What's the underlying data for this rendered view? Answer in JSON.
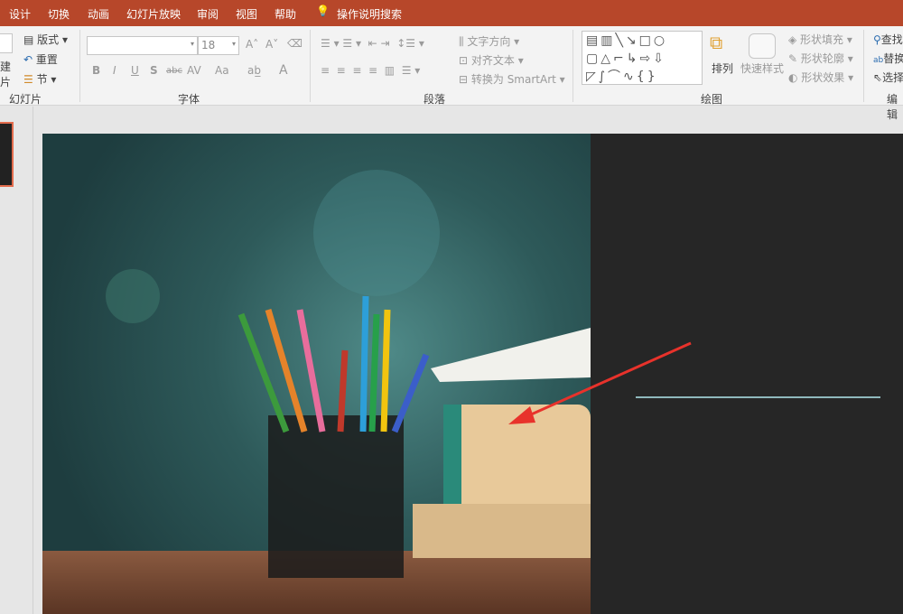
{
  "tabs": [
    "设计",
    "切换",
    "动画",
    "幻灯片放映",
    "审阅",
    "视图",
    "帮助"
  ],
  "tell_me": "操作说明搜索",
  "slides_group": {
    "new_slide": "建",
    "new_slide2": "片",
    "layout": "版式",
    "reset": "重置",
    "section": "节",
    "label": "幻灯片"
  },
  "font_group": {
    "font_name": "",
    "font_size": "18",
    "label": "字体",
    "bold": "B",
    "italic": "I",
    "underline": "U",
    "shadow": "S",
    "strike": "abc",
    "spacing": "AV",
    "case": "Aa",
    "color": "A"
  },
  "paragraph_group": {
    "text_direction": "文字方向",
    "align_text": "对齐文本",
    "smartart": "转换为 SmartArt",
    "label": "段落"
  },
  "drawing_group": {
    "arrange": "排列",
    "quick_styles": "快速样式",
    "shape_fill": "形状填充",
    "shape_outline": "形状轮廓",
    "shape_effects": "形状效果",
    "label": "绘图"
  },
  "editing_group": {
    "find": "查找",
    "replace": "替换",
    "select": "选择",
    "label": "编辑"
  },
  "colors": {
    "accent": "#b7472a",
    "arrow": "#e8322b",
    "line": "#8fb8bc"
  }
}
